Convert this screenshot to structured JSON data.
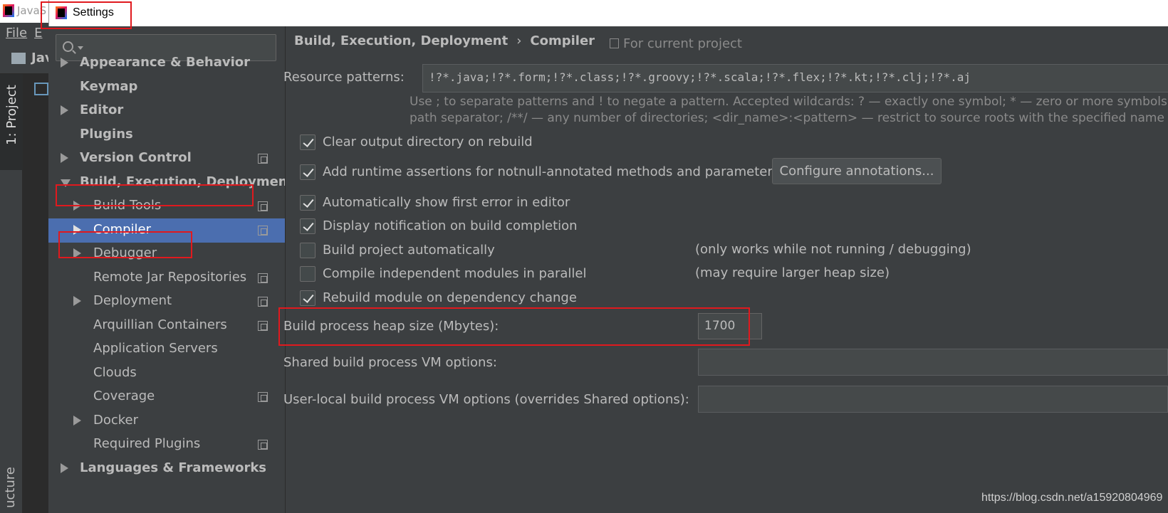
{
  "ide": {
    "title_fragment": "JavaS",
    "menu": [
      "File",
      "E"
    ],
    "toolbar_fragment": "Jav",
    "project_tab": "1: Project",
    "structure_tab": "ucture"
  },
  "settings": {
    "window_title": "Settings",
    "search": {
      "value": "",
      "placeholder": ""
    },
    "tree": [
      {
        "label": "Appearance & Behavior",
        "level": 0,
        "arrow": "right",
        "project_icon": false,
        "selected": false
      },
      {
        "label": "Keymap",
        "level": 0,
        "arrow": "none",
        "project_icon": false,
        "selected": false
      },
      {
        "label": "Editor",
        "level": 0,
        "arrow": "right",
        "project_icon": false,
        "selected": false
      },
      {
        "label": "Plugins",
        "level": 0,
        "arrow": "none",
        "project_icon": false,
        "selected": false
      },
      {
        "label": "Version Control",
        "level": 0,
        "arrow": "right",
        "project_icon": true,
        "selected": false
      },
      {
        "label": "Build, Execution, Deployment",
        "level": 0,
        "arrow": "down",
        "project_icon": false,
        "selected": false
      },
      {
        "label": "Build Tools",
        "level": 1,
        "arrow": "right",
        "project_icon": true,
        "selected": false
      },
      {
        "label": "Compiler",
        "level": 1,
        "arrow": "right",
        "project_icon": true,
        "selected": true
      },
      {
        "label": "Debugger",
        "level": 1,
        "arrow": "right",
        "project_icon": false,
        "selected": false
      },
      {
        "label": "Remote Jar Repositories",
        "level": 1,
        "arrow": "none",
        "project_icon": true,
        "selected": false
      },
      {
        "label": "Deployment",
        "level": 1,
        "arrow": "right",
        "project_icon": true,
        "selected": false
      },
      {
        "label": "Arquillian Containers",
        "level": 1,
        "arrow": "none",
        "project_icon": true,
        "selected": false
      },
      {
        "label": "Application Servers",
        "level": 1,
        "arrow": "none",
        "project_icon": false,
        "selected": false
      },
      {
        "label": "Clouds",
        "level": 1,
        "arrow": "none",
        "project_icon": false,
        "selected": false
      },
      {
        "label": "Coverage",
        "level": 1,
        "arrow": "none",
        "project_icon": true,
        "selected": false
      },
      {
        "label": "Docker",
        "level": 1,
        "arrow": "right",
        "project_icon": false,
        "selected": false
      },
      {
        "label": "Required Plugins",
        "level": 1,
        "arrow": "none",
        "project_icon": true,
        "selected": false
      },
      {
        "label": "Languages & Frameworks",
        "level": 0,
        "arrow": "right",
        "project_icon": false,
        "selected": false
      }
    ]
  },
  "compiler": {
    "breadcrumb": [
      "Build, Execution, Deployment",
      "Compiler"
    ],
    "breadcrumb_sep": "›",
    "scope": "For current project",
    "resource_patterns_label": "Resource patterns:",
    "resource_patterns_value": "!?*.java;!?*.form;!?*.class;!?*.groovy;!?*.scala;!?*.flex;!?*.kt;!?*.clj;!?*.aj",
    "hint_line1": "Use ; to separate patterns and ! to negate a pattern. Accepted wildcards: ? — exactly one symbol; * — zero or more symbols; / —",
    "hint_line2": "path separator; /**/ — any number of directories; <dir_name>:<pattern> — restrict to source roots with the specified name",
    "options": [
      {
        "label": "Clear output directory on rebuild",
        "checked": true,
        "note": ""
      },
      {
        "label": "Add runtime assertions for notnull-annotated methods and parameters",
        "checked": true,
        "note": ""
      },
      {
        "label": "Automatically show first error in editor",
        "checked": true,
        "note": ""
      },
      {
        "label": "Display notification on build completion",
        "checked": true,
        "note": ""
      },
      {
        "label": "Build project automatically",
        "checked": false,
        "note": "(only works while not running / debugging)"
      },
      {
        "label": "Compile independent modules in parallel",
        "checked": false,
        "note": "(may require larger heap size)"
      },
      {
        "label": "Rebuild module on dependency change",
        "checked": true,
        "note": ""
      }
    ],
    "configure_button": "Configure annotations...",
    "heap_label": "Build process heap size (Mbytes):",
    "heap_value": "1700",
    "shared_vm_label": "Shared build process VM options:",
    "shared_vm_value": "",
    "user_vm_label": "User-local build process VM options (overrides Shared options):",
    "user_vm_value": ""
  },
  "watermark": "https://blog.csdn.net/a15920804969",
  "colors": {
    "background": "#3c3f41",
    "selection": "#4b6eaf",
    "annotation_red": "#e0191e",
    "text": "#bbbbbb"
  }
}
